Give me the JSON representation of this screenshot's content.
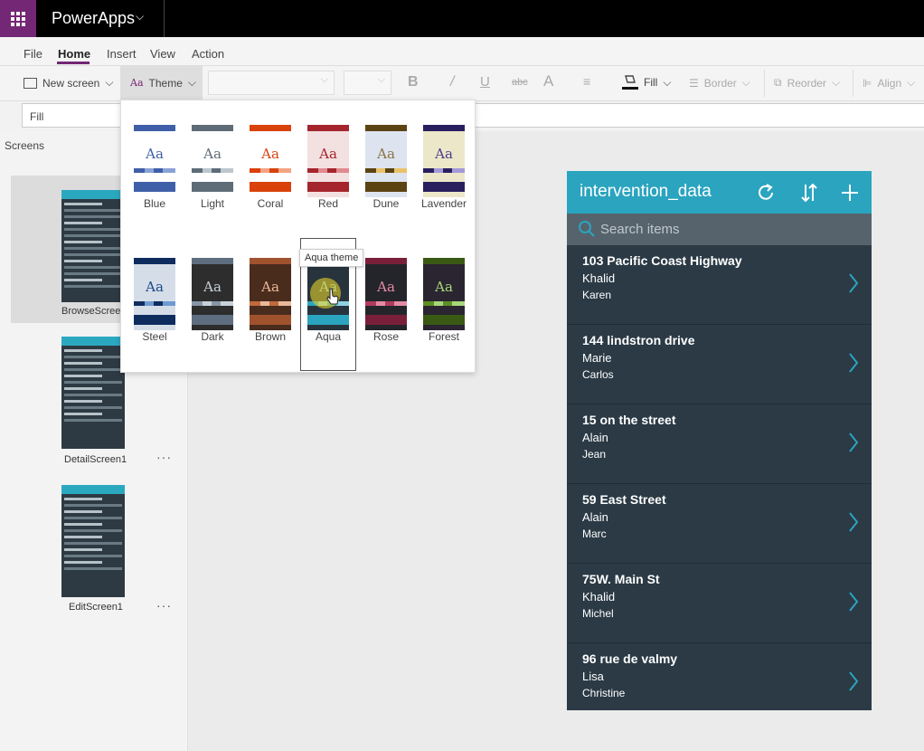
{
  "app": {
    "name": "PowerApps"
  },
  "menu": {
    "items": [
      "File",
      "Home",
      "Insert",
      "View",
      "Action"
    ],
    "active": "Home"
  },
  "toolbar": {
    "new_screen": "New screen",
    "theme": "Theme",
    "fill": "Fill",
    "border": "Border",
    "reorder": "Reorder",
    "align": "Align"
  },
  "formula": {
    "property": "Fill"
  },
  "screens": {
    "label": "Screens",
    "items": [
      {
        "name": "BrowseScreen1"
      },
      {
        "name": "DetailScreen1"
      },
      {
        "name": "EditScreen1"
      }
    ]
  },
  "themes": {
    "tooltip": "Aqua theme",
    "items": [
      {
        "name": "Blue",
        "bar": "#3f5fa8",
        "bg": "#ffffff",
        "aa": "#3f5fa8",
        "bot": "#3f5fa8",
        "d1": "#3f5fa8",
        "d2": "#8aa3d6"
      },
      {
        "name": "Light",
        "bar": "#5e6c78",
        "bg": "#ffffff",
        "aa": "#5e6c78",
        "bot": "#5e6c78",
        "d1": "#5e6c78",
        "d2": "#bcc6cd"
      },
      {
        "name": "Coral",
        "bar": "#d9420b",
        "bg": "#ffffff",
        "aa": "#d9420b",
        "bot": "#d9420b",
        "d1": "#d9420b",
        "d2": "#f3a383"
      },
      {
        "name": "Red",
        "bar": "#a4262c",
        "bg": "#f3e0e1",
        "aa": "#a4262c",
        "bot": "#a4262c",
        "d1": "#a4262c",
        "d2": "#e08a8f"
      },
      {
        "name": "Dune",
        "bar": "#5b4312",
        "bg": "#dde4f0",
        "aa": "#8a7344",
        "bot": "#5b4312",
        "d1": "#5b4312",
        "d2": "#e9c36a"
      },
      {
        "name": "Lavender",
        "bar": "#2a1f5e",
        "bg": "#ece7c8",
        "aa": "#4b3e8a",
        "bot": "#2a1f5e",
        "d1": "#2a1f5e",
        "d2": "#a598d8"
      },
      {
        "name": "Steel",
        "bar": "#0e2c5e",
        "bg": "#d5dde8",
        "aa": "#1c4a8c",
        "bot": "#0e2c5e",
        "d1": "#0e2c5e",
        "d2": "#6f9ad0"
      },
      {
        "name": "Dark",
        "bar": "#5e6e80",
        "bg": "#2d2d2d",
        "aa": "#c8d0d8",
        "bot": "#5e6e80",
        "d1": "#8796a6",
        "d2": "#c8d0d8"
      },
      {
        "name": "Brown",
        "bar": "#a0522d",
        "bg": "#4a2c1d",
        "aa": "#e8b89a",
        "bot": "#a0522d",
        "d1": "#c06a3e",
        "d2": "#e8b89a"
      },
      {
        "name": "Aqua",
        "bar": "#2aa4bf",
        "bg": "#27343d",
        "aa": "#8fd2e2",
        "bot": "#2aa4bf",
        "d1": "#2aa4bf",
        "d2": "#8fd2e2"
      },
      {
        "name": "Rose",
        "bar": "#7a1f3a",
        "bg": "#24252a",
        "aa": "#e58aa5",
        "bot": "#7a1f3a",
        "d1": "#b13a5e",
        "d2": "#e58aa5"
      },
      {
        "name": "Forest",
        "bar": "#3a5a14",
        "bg": "#2a2530",
        "aa": "#a8d67a",
        "bot": "#3a5a14",
        "d1": "#5e8f24",
        "d2": "#a8d67a"
      }
    ]
  },
  "preview": {
    "title": "intervention_data",
    "search_placeholder": "Search items",
    "items": [
      {
        "title": "103 Pacific Coast Highway",
        "subtitle": "Khalid",
        "body": "Karen"
      },
      {
        "title": "144 lindstron drive",
        "subtitle": "Marie",
        "body": "Carlos"
      },
      {
        "title": "15 on the street",
        "subtitle": "Alain",
        "body": "Jean"
      },
      {
        "title": "59 East Street",
        "subtitle": "Alain",
        "body": "Marc"
      },
      {
        "title": "75W. Main St",
        "subtitle": "Khalid",
        "body": "Michel"
      },
      {
        "title": "96 rue de valmy",
        "subtitle": "Lisa",
        "body": "Christine"
      }
    ]
  }
}
